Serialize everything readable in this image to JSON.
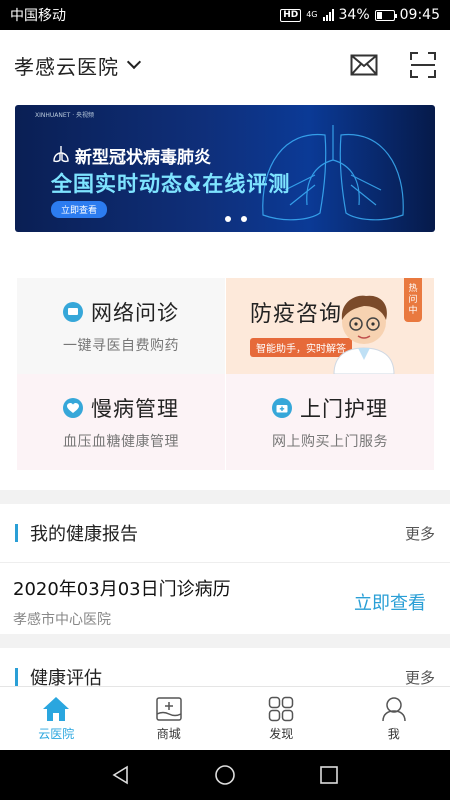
{
  "status_bar": {
    "carrier": "中国移动",
    "hd": "HD",
    "network": "4G",
    "battery": "34%",
    "battery_level": 0.34,
    "time": "09:45"
  },
  "header": {
    "hospital": "孝感云医院"
  },
  "banner": {
    "title": "新型冠状病毒肺炎",
    "subtitle": "全国实时动态&在线评测",
    "button": "立即查看",
    "active_slide": 1,
    "slide_count": 2
  },
  "services": [
    {
      "title": "网络问诊",
      "subtitle": "一键寻医自费购药"
    },
    {
      "title": "防疫咨询",
      "tag": "智能助手，实时解答",
      "badge": "热问中"
    },
    {
      "title": "慢病管理",
      "subtitle": "血压血糖健康管理"
    },
    {
      "title": "上门护理",
      "subtitle": "网上购买上门服务"
    }
  ],
  "health_report": {
    "title": "我的健康报告",
    "more": "更多",
    "record": {
      "title": "2020年03月03日门诊病历",
      "hospital": "孝感市中心医院",
      "action": "立即查看"
    }
  },
  "health_eval": {
    "title": "健康评估",
    "more": "更多"
  },
  "tabs": [
    {
      "label": "云医院",
      "icon": "home-icon",
      "active": true
    },
    {
      "label": "商城",
      "icon": "shop-icon",
      "active": false
    },
    {
      "label": "发现",
      "icon": "grid-icon",
      "active": false
    },
    {
      "label": "我",
      "icon": "user-icon",
      "active": false
    }
  ],
  "colors": {
    "accent": "#2aa6df",
    "orange": "#e66a3a"
  }
}
